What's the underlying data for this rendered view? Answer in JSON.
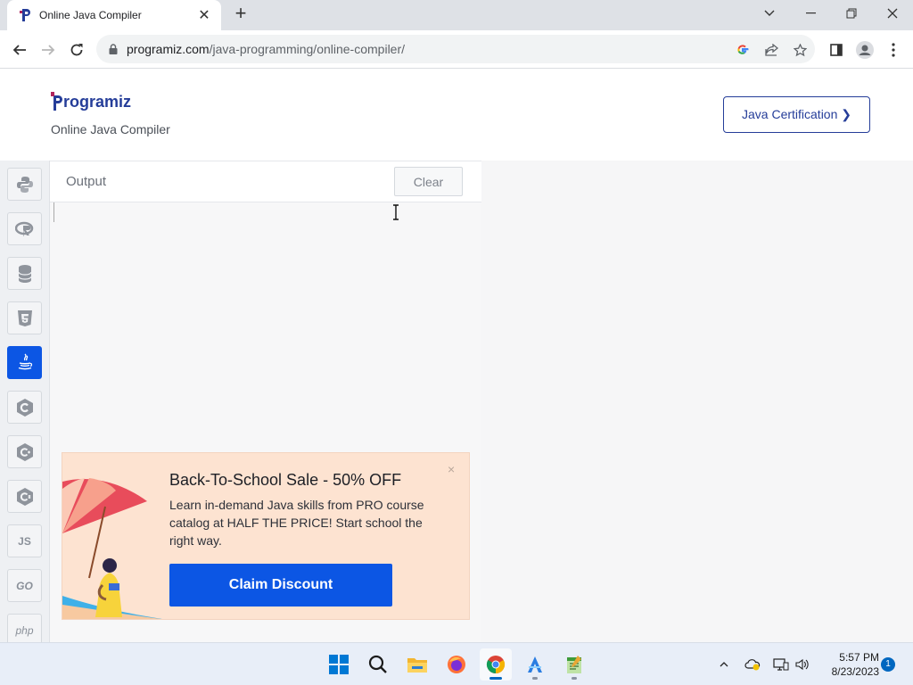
{
  "browser": {
    "tab_title": "Online Java Compiler",
    "url_host": "programiz.com",
    "url_path": "/java-programming/online-compiler/"
  },
  "site": {
    "logo_text": "rogramiz",
    "subtitle": "Online Java Compiler",
    "cert_button": "Java Certification ❯"
  },
  "sidebar": {
    "items": [
      {
        "name": "python",
        "label": ""
      },
      {
        "name": "r",
        "label": ""
      },
      {
        "name": "sql",
        "label": ""
      },
      {
        "name": "html",
        "label": ""
      },
      {
        "name": "java",
        "label": "",
        "active": true
      },
      {
        "name": "c",
        "label": ""
      },
      {
        "name": "cpp",
        "label": ""
      },
      {
        "name": "csharp",
        "label": ""
      },
      {
        "name": "js",
        "label": "JS"
      },
      {
        "name": "go",
        "label": "GO"
      },
      {
        "name": "php",
        "label": "php"
      }
    ]
  },
  "output": {
    "title": "Output",
    "clear_label": "Clear"
  },
  "promo": {
    "title": "Back-To-School Sale - 50% OFF",
    "text": "Learn in-demand Java skills from PRO course catalog at HALF THE PRICE! Start school the right way.",
    "button": "Claim Discount",
    "close": "×"
  },
  "taskbar": {
    "time": "5:57 PM",
    "date": "8/23/2023",
    "notifications": "1"
  },
  "colors": {
    "brand": "#253d99",
    "accent": "#0c56e4",
    "promo_bg": "#fde3d1"
  }
}
